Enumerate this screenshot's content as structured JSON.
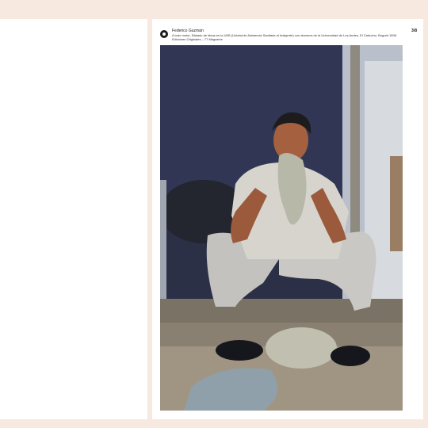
{
  "header": {
    "author": "Federico Guzmán",
    "caption": "A todo motor, Sábado de ideas en la UKB (Unidad de Asistencia Sanitaria al Indigente) con alumnos de la Universidad de Los Andes, El Cartucho, Bogotá 1998. Ediciones Originales – 77 Magazine",
    "page_number": "3/8"
  },
  "colors": {
    "background": "#f7e8e0",
    "page": "#ffffff"
  }
}
